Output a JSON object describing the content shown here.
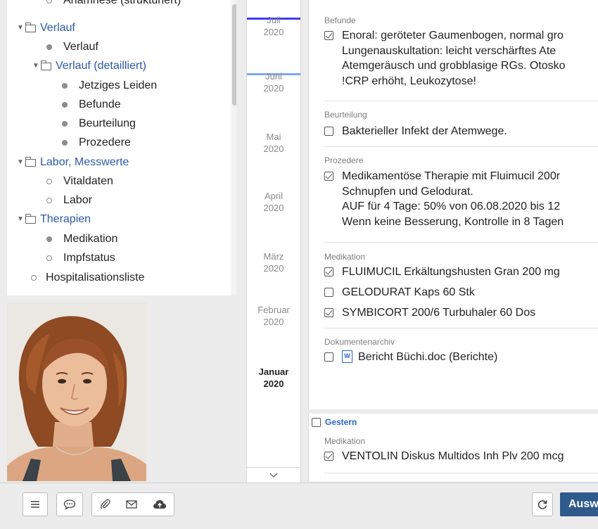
{
  "tree": {
    "items": [
      {
        "label": "Anamnese (strukturiert)",
        "type": "empty-dot"
      },
      {
        "label": "Verlauf",
        "type": "folder",
        "expanded": true
      },
      {
        "label": "Verlauf",
        "type": "filled-dot"
      },
      {
        "label": "Verlauf (detailliert)",
        "type": "folder",
        "expanded": true
      },
      {
        "label": "Jetziges Leiden",
        "type": "filled-dot"
      },
      {
        "label": "Befunde",
        "type": "filled-dot"
      },
      {
        "label": "Beurteilung",
        "type": "filled-dot"
      },
      {
        "label": "Prozedere",
        "type": "filled-dot"
      },
      {
        "label": "Labor, Messwerte",
        "type": "folder",
        "expanded": true
      },
      {
        "label": "Vitaldaten",
        "type": "empty-dot"
      },
      {
        "label": "Labor",
        "type": "empty-dot"
      },
      {
        "label": "Therapien",
        "type": "folder",
        "expanded": true
      },
      {
        "label": "Medikation",
        "type": "filled-dot"
      },
      {
        "label": "Impfstatus",
        "type": "empty-dot"
      },
      {
        "label": "Hospitalisationsliste",
        "type": "empty-dot"
      }
    ]
  },
  "timeline": {
    "months": [
      {
        "name": "Juli",
        "year": "2020"
      },
      {
        "name": "Juni",
        "year": "2020"
      },
      {
        "name": "Mai",
        "year": "2020"
      },
      {
        "name": "April",
        "year": "2020"
      },
      {
        "name": "März",
        "year": "2020"
      },
      {
        "name": "Februar",
        "year": "2020"
      },
      {
        "name": "Januar",
        "year": "2020"
      }
    ],
    "scroll_down_icon": "chevron-down-icon"
  },
  "content": {
    "befunde": {
      "heading": "Befunde",
      "checked": true,
      "lines": [
        "Enoral: geröteter Gaumenbogen, normal gro",
        "Lungenauskultation: leicht verschärftes Ate",
        "Atemgeräusch und grobblasige RGs. Otosko",
        "!CRP erhöht, Leukozytose!"
      ]
    },
    "beurteilung": {
      "heading": "Beurteilung",
      "checked": false,
      "text": "Bakterieller Infekt der Atemwege."
    },
    "prozedere": {
      "heading": "Prozedere",
      "checked": true,
      "lines": [
        "Medikamentöse Therapie mit Fluimucil 200r",
        "Schnupfen und Gelodurat.",
        "AUF für 4 Tage: 50% von 06.08.2020 bis 12",
        "Wenn keine Besserung, Kontrolle in 8 Tagen"
      ]
    },
    "medikation": {
      "heading": "Medikation",
      "items": [
        {
          "label": "FLUIMUCIL Erkältungshusten Gran 200 mg",
          "checked": true
        },
        {
          "label": "GELODURAT Kaps 60 Stk",
          "checked": false
        },
        {
          "label": "SYMBICORT 200/6 Turbuhaler 60 Dos",
          "checked": true
        }
      ]
    },
    "dokumentenarchiv": {
      "heading": "Dokumentenarchiv",
      "item": {
        "label": "Bericht Büchi.doc (Berichte)",
        "checked": false,
        "icon_glyph": "W"
      }
    }
  },
  "gestern": {
    "label": "Gestern",
    "heading": "Medikation",
    "item": {
      "label": "VENTOLIN Diskus Multidos Inh Plv 200 mcg",
      "checked": true
    }
  },
  "toolbar": {
    "buttons": [
      "menu-icon",
      "comment-icon",
      "attachment-icon",
      "mail-icon",
      "cloud-upload-icon"
    ],
    "refresh_icon": "refresh-icon",
    "primary_label": "Ausw"
  },
  "colors": {
    "link": "#2d5aa6",
    "timeline_current": "#3d3df0",
    "timeline_secondary": "#7fa6ef",
    "primary_button": "#2f5a8c"
  }
}
